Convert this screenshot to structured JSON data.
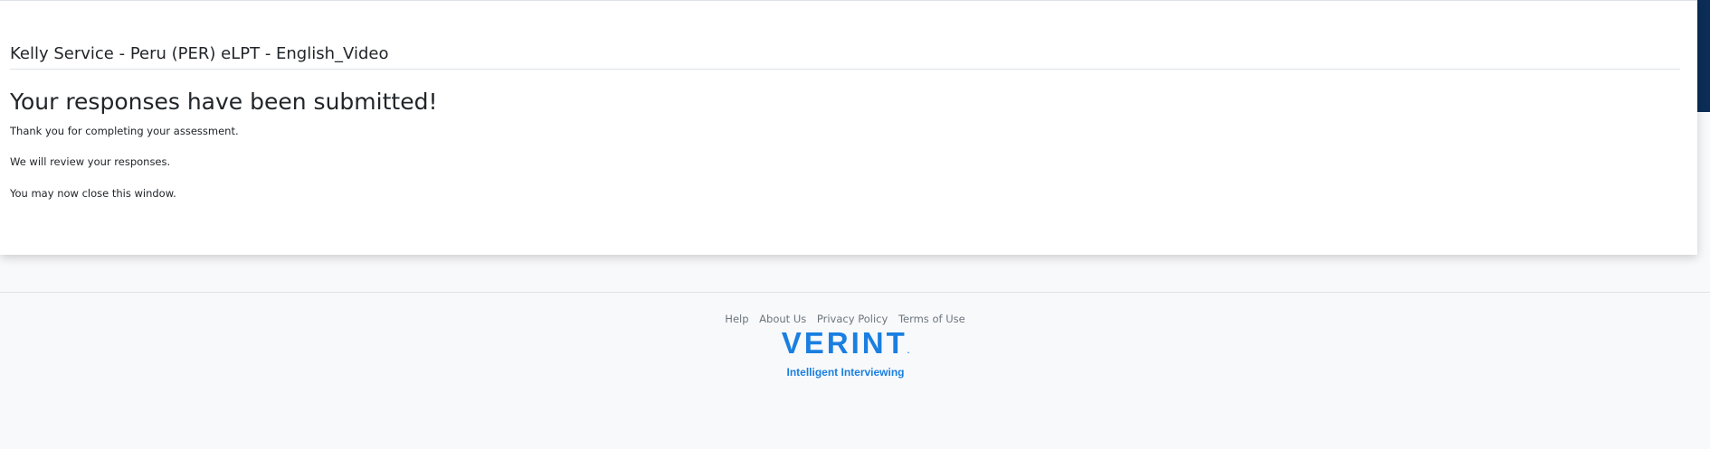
{
  "card": {
    "assessment_title": "Kelly Service - Peru (PER) eLPT - English_Video",
    "heading": "Your responses have been submitted!",
    "messages": [
      "Thank you for completing your assessment.",
      "We will review your responses.",
      "You may now close this window."
    ]
  },
  "footer": {
    "links": [
      "Help",
      "About Us",
      "Privacy Policy",
      "Terms of Use"
    ],
    "logo": {
      "wordmark": "VERINT",
      "mark": ".",
      "tagline": "Intelligent Interviewing",
      "color": "#1a7fe0"
    }
  },
  "colors": {
    "accent_bar": "#0b2d57",
    "background": "#f8f9fb",
    "card": "#ffffff"
  }
}
